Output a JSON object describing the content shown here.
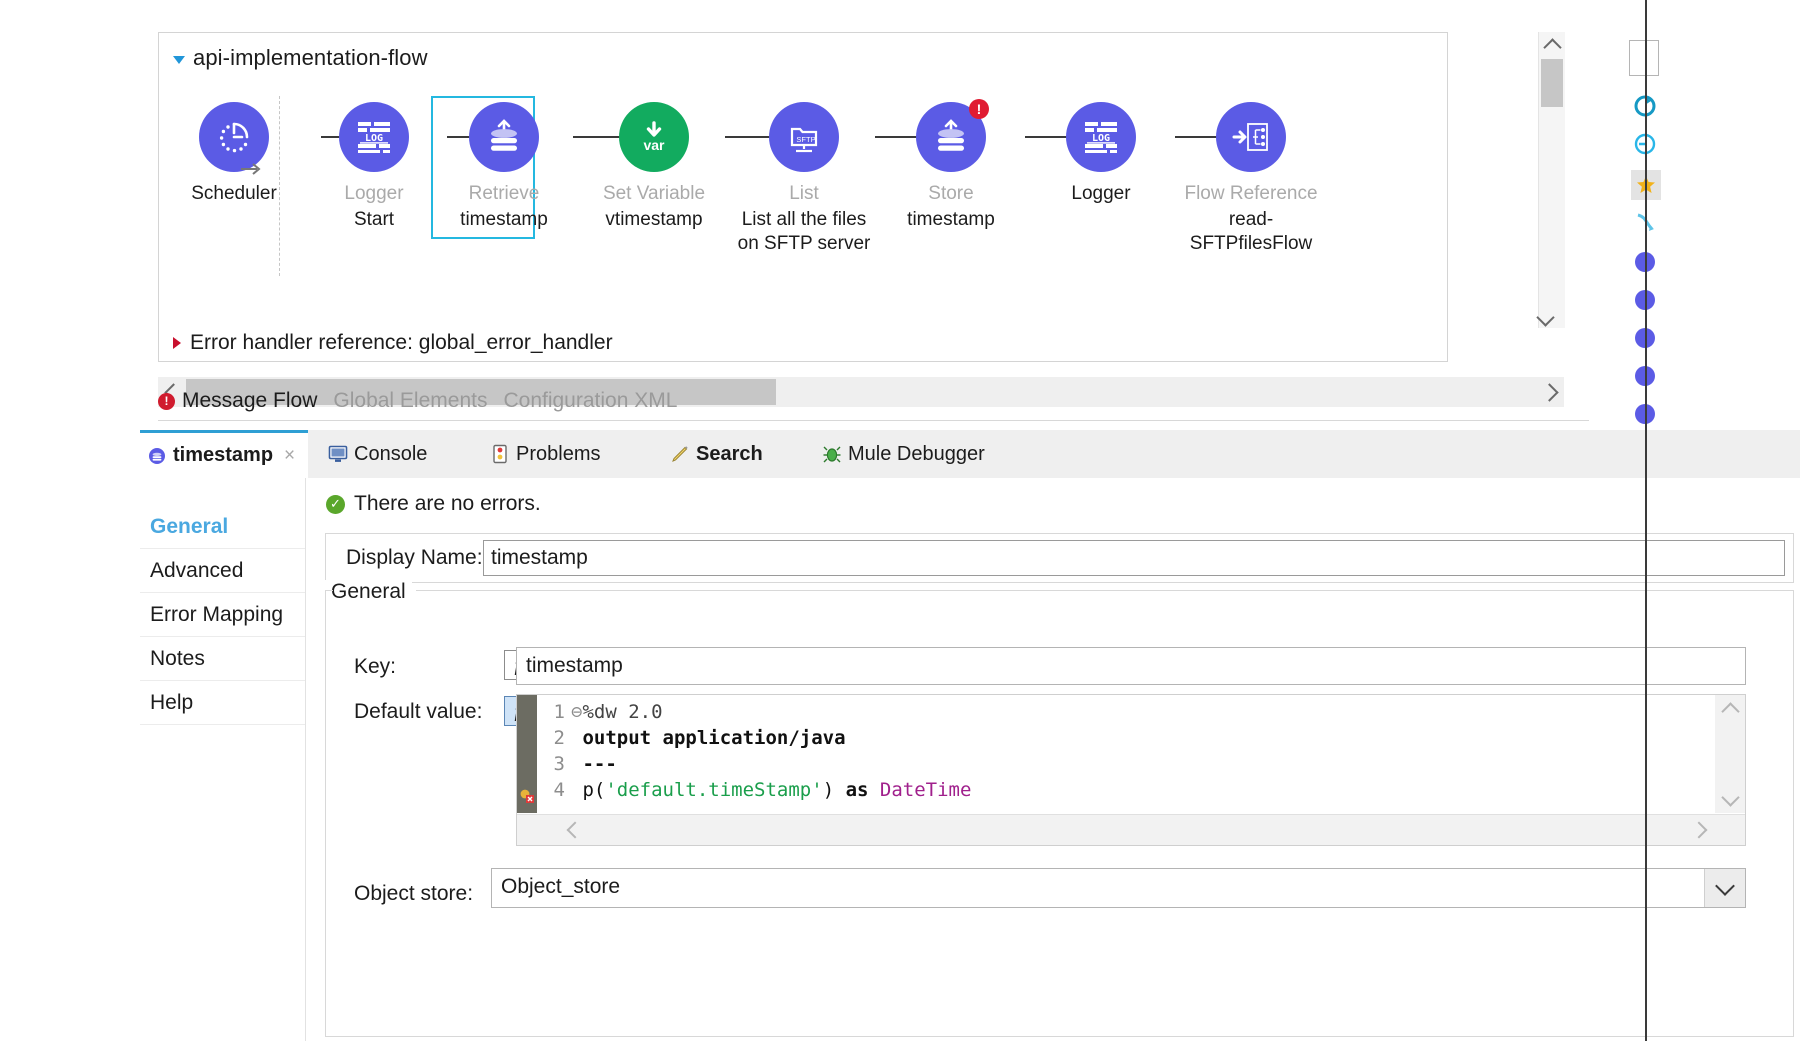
{
  "canvas": {
    "flow_name": "api-implementation-flow",
    "error_handler_label": "Error handler reference: global_error_handler",
    "nodes": [
      {
        "type": "Scheduler",
        "name": "",
        "icon": "scheduler-clock-icon",
        "color": "#5b5be5",
        "type_dark": true,
        "error": false,
        "selected": false
      },
      {
        "type": "Logger",
        "name": "Start",
        "icon": "logger-log-icon",
        "color": "#5b5be5",
        "type_dark": false,
        "error": false,
        "selected": false
      },
      {
        "type": "Retrieve",
        "name": "timestamp",
        "icon": "objectstore-retrieve-icon",
        "color": "#5b5be5",
        "type_dark": false,
        "error": false,
        "selected": true
      },
      {
        "type": "Set Variable",
        "name": "vtimestamp",
        "icon": "set-variable-var-icon",
        "color": "#12ab5f",
        "type_dark": false,
        "error": false,
        "selected": false
      },
      {
        "type": "List",
        "name": "List all the files on SFTP server",
        "icon": "sftp-list-icon",
        "color": "#5b5be5",
        "type_dark": false,
        "error": false,
        "selected": false
      },
      {
        "type": "Store",
        "name": "timestamp",
        "icon": "objectstore-store-icon",
        "color": "#5b5be5",
        "type_dark": false,
        "error": true,
        "selected": false
      },
      {
        "type": "Logger",
        "name": "",
        "icon": "logger-log-icon",
        "color": "#5b5be5",
        "type_dark": true,
        "error": false,
        "selected": false
      },
      {
        "type": "Flow Reference",
        "name": "read-SFTPfilesFlow",
        "icon": "flow-reference-icon",
        "color": "#5b5be5",
        "type_dark": false,
        "error": false,
        "selected": false
      }
    ]
  },
  "editor_tabs": [
    {
      "label": "Message Flow",
      "active": true,
      "has_error_icon": true
    },
    {
      "label": "Global Elements",
      "active": false,
      "has_error_icon": false
    },
    {
      "label": "Configuration XML",
      "active": false,
      "has_error_icon": false
    }
  ],
  "view_tabs": {
    "active": {
      "label": "timestamp",
      "icon": "objectstore-icon",
      "close": "×"
    },
    "others": [
      {
        "label": "Console",
        "icon": "console-icon"
      },
      {
        "label": "Problems",
        "icon": "problems-icon"
      },
      {
        "label": "Search",
        "icon": "search-pencil-icon"
      },
      {
        "label": "Mule Debugger",
        "icon": "mule-debugger-icon"
      }
    ]
  },
  "properties": {
    "sidebar": [
      {
        "label": "General",
        "active": true
      },
      {
        "label": "Advanced",
        "active": false
      },
      {
        "label": "Error Mapping",
        "active": false
      },
      {
        "label": "Notes",
        "active": false
      },
      {
        "label": "Help",
        "active": false
      }
    ],
    "status_message": "There are no errors.",
    "status_icon": "✓",
    "display_name_label": "Display Name:",
    "display_name_value": "timestamp",
    "group_legend": "General",
    "key_label": "Key:",
    "key_fx": "fx",
    "key_value": "timestamp",
    "default_value_label": "Default value:",
    "default_value_fx": "fx",
    "object_store_label": "Object store:",
    "object_store_value": "Object_store",
    "code": {
      "lines": [
        {
          "n": "1",
          "fold": "⊖",
          "tokens": [
            {
              "t": "%dw 2.0",
              "c": "dim"
            }
          ]
        },
        {
          "n": "2",
          "fold": " ",
          "tokens": [
            {
              "t": "output application/java",
              "c": "kw"
            }
          ]
        },
        {
          "n": "3",
          "fold": " ",
          "tokens": [
            {
              "t": "---",
              "c": "kw"
            }
          ]
        },
        {
          "n": "4",
          "fold": " ",
          "tokens": [
            {
              "t": "p(",
              "c": "plain"
            },
            {
              "t": "'default.timeStamp'",
              "c": "str"
            },
            {
              "t": ") ",
              "c": "plain"
            },
            {
              "t": "as ",
              "c": "kw"
            },
            {
              "t": "DateTime",
              "c": "typ"
            }
          ]
        }
      ]
    }
  },
  "colors": {
    "node_purple": "#5b5be5",
    "node_green": "#12ab5f",
    "selection": "#24b8e0",
    "error_red": "#e01b32",
    "accent_blue": "#4aa8e0",
    "ok_green": "#5aa72b"
  }
}
